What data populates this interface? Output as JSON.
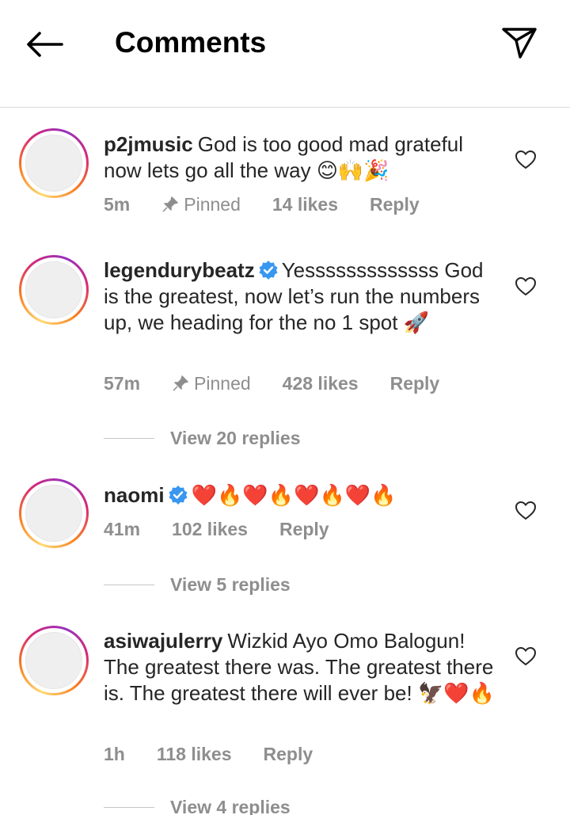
{
  "header": {
    "title": "Comments",
    "back_icon": "arrow-left-icon",
    "send_icon": "paper-plane-icon"
  },
  "comments": [
    {
      "username": "p2jmusic",
      "verified": false,
      "text": "God is too good mad grateful now lets go all the way",
      "emojis": "😊🙌🎉",
      "time": "5m",
      "pinned": "Pinned",
      "likes": "14 likes",
      "reply": "Reply"
    },
    {
      "username": "legendurybeatz",
      "verified": true,
      "text": "Yesssssssssssss God is the greatest, now let’s run the numbers up, we heading for the no 1 spot",
      "emojis": "🚀",
      "time": "57m",
      "pinned": "Pinned",
      "likes": "428 likes",
      "reply": "Reply",
      "view_replies": "View 20 replies"
    },
    {
      "username": "naomi",
      "verified": true,
      "text": "",
      "emojis": "❤️🔥❤️🔥❤️🔥❤️🔥",
      "time": "41m",
      "likes": "102 likes",
      "reply": "Reply",
      "view_replies": "View 5 replies"
    },
    {
      "username": "asiwajulerry",
      "verified": false,
      "text": "Wizkid Ayo Omo Balogun! The greatest there was. The greatest there is. The greatest there will ever be!",
      "emojis": "🦅❤️🔥",
      "time": "1h",
      "likes": "118 likes",
      "reply": "Reply",
      "view_replies": "View 4 replies"
    }
  ],
  "colors": {
    "text": "#262626",
    "muted": "#8e8e8e",
    "verified_blue": "#3897f0",
    "divider": "#dbdbdb"
  }
}
